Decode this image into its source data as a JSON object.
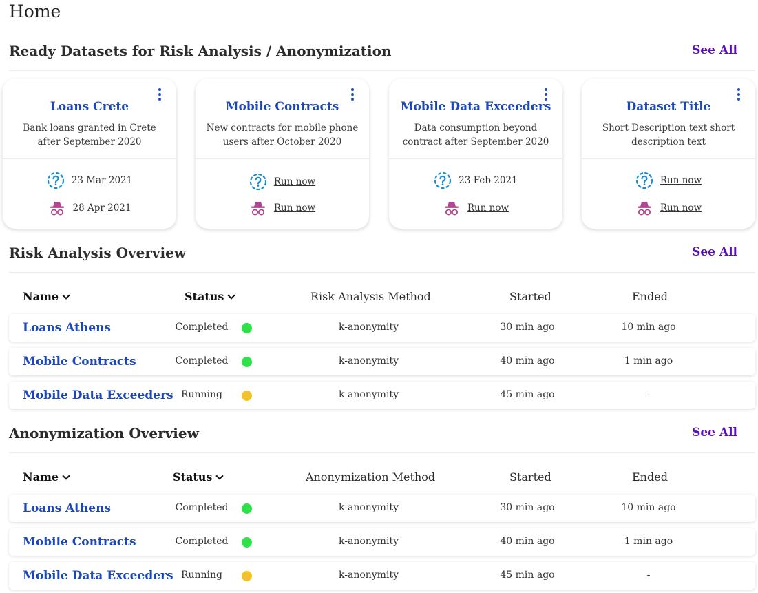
{
  "page": {
    "title": "Home"
  },
  "colors": {
    "completed": "#2ee14a",
    "running": "#f2c12e",
    "link": "#1d47b8",
    "see_all": "#5a10b5",
    "risk_icon": "#1a8bd1",
    "anon_icon": "#b0478e"
  },
  "datasets": {
    "title": "Ready Datasets for Risk Analysis / Anonymization",
    "see_all": "See All",
    "cards": [
      {
        "title": "Loans Crete",
        "description": "Bank loans granted in Crete after September 2020",
        "risk": "23 Mar 2021",
        "risk_is_action": false,
        "anon": "28 Apr 2021",
        "anon_is_action": false
      },
      {
        "title": "Mobile Contracts",
        "description": "New contracts for mobile phone users after October 2020",
        "risk": "Run now",
        "risk_is_action": true,
        "anon": "Run now",
        "anon_is_action": true
      },
      {
        "title": "Mobile Data Exceeders",
        "description": "Data consumption beyond contract after September 2020",
        "risk": "23 Feb 2021",
        "risk_is_action": false,
        "anon": "Run now",
        "anon_is_action": true
      },
      {
        "title": "Dataset Title",
        "description": "Short Description text short description text",
        "risk": "Run now",
        "risk_is_action": true,
        "anon": "Run now",
        "anon_is_action": true
      }
    ]
  },
  "risk": {
    "title": "Risk Analysis Overview",
    "see_all": "See All",
    "columns": {
      "name": "Name",
      "status": "Status",
      "method": "Risk Analysis Method",
      "started": "Started",
      "ended": "Ended"
    },
    "rows": [
      {
        "name": "Loans Athens",
        "status": "Completed",
        "state": "completed",
        "method": "k-anonymity",
        "started": "30 min ago",
        "ended": "10 min ago"
      },
      {
        "name": "Mobile Contracts",
        "status": "Completed",
        "state": "completed",
        "method": "k-anonymity",
        "started": "40 min ago",
        "ended": "1 min ago"
      },
      {
        "name": "Mobile Data Exceeders",
        "status": "Running",
        "state": "running",
        "method": "k-anonymity",
        "started": "45 min ago",
        "ended": "-"
      }
    ]
  },
  "anon": {
    "title": "Anonymization Overview",
    "see_all": "See All",
    "columns": {
      "name": "Name",
      "status": "Status",
      "method": "Anonymization Method",
      "started": "Started",
      "ended": "Ended"
    },
    "rows": [
      {
        "name": "Loans Athens",
        "status": "Completed",
        "state": "completed",
        "method": "k-anonymity",
        "started": "30 min ago",
        "ended": "10 min ago"
      },
      {
        "name": "Mobile Contracts",
        "status": "Completed",
        "state": "completed",
        "method": "k-anonymity",
        "started": "40 min ago",
        "ended": "1 min ago"
      },
      {
        "name": "Mobile Data Exceeders",
        "status": "Running",
        "state": "running",
        "method": "k-anonymity",
        "started": "45 min ago",
        "ended": "-"
      }
    ]
  }
}
